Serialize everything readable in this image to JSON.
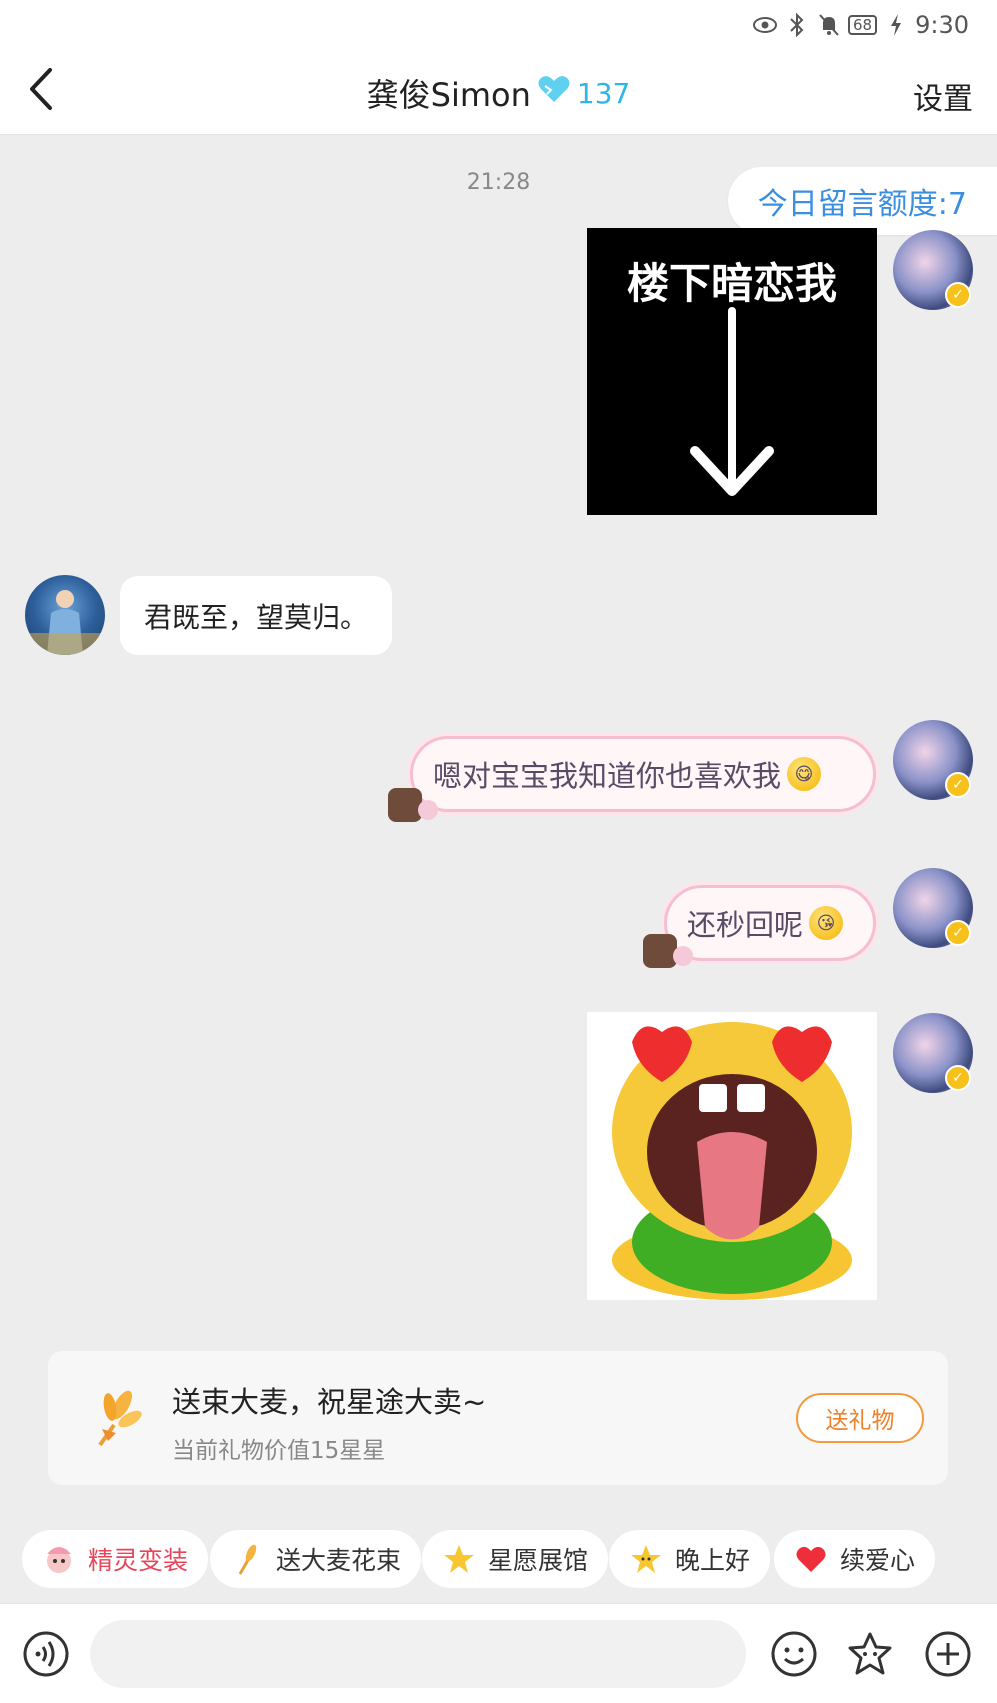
{
  "status_bar": {
    "time": "9:30",
    "battery": "68"
  },
  "header": {
    "title": "龚俊Simon",
    "intimacy": "137",
    "settings_label": "设置"
  },
  "chat": {
    "timestamp": "21:28",
    "quota_label": "今日留言额度:7",
    "image_caption": "楼下暗恋我",
    "incoming_text": "君既至，望莫归。",
    "outgoing_1": "嗯对宝宝我知道你也喜欢我",
    "outgoing_2": "还秒回呢"
  },
  "gift": {
    "title": "送束大麦，祝星途大卖~",
    "subtitle": "当前礼物价值15星星",
    "button_label": "送礼物"
  },
  "chips": [
    {
      "label": "精灵变装",
      "icon": "sprite-costume-icon"
    },
    {
      "label": "送大麦花束",
      "icon": "wheat-bouquet-icon"
    },
    {
      "label": "星愿展馆",
      "icon": "star-icon"
    },
    {
      "label": "晚上好",
      "icon": "star-face-icon"
    },
    {
      "label": "续爱心",
      "icon": "heart-icon"
    }
  ],
  "input": {
    "placeholder": ""
  },
  "colors": {
    "accent_blue": "#3a8fe0",
    "gift_orange": "#f0812a",
    "chip_red": "#e8455a",
    "intimacy_cyan": "#2eb6e6"
  }
}
